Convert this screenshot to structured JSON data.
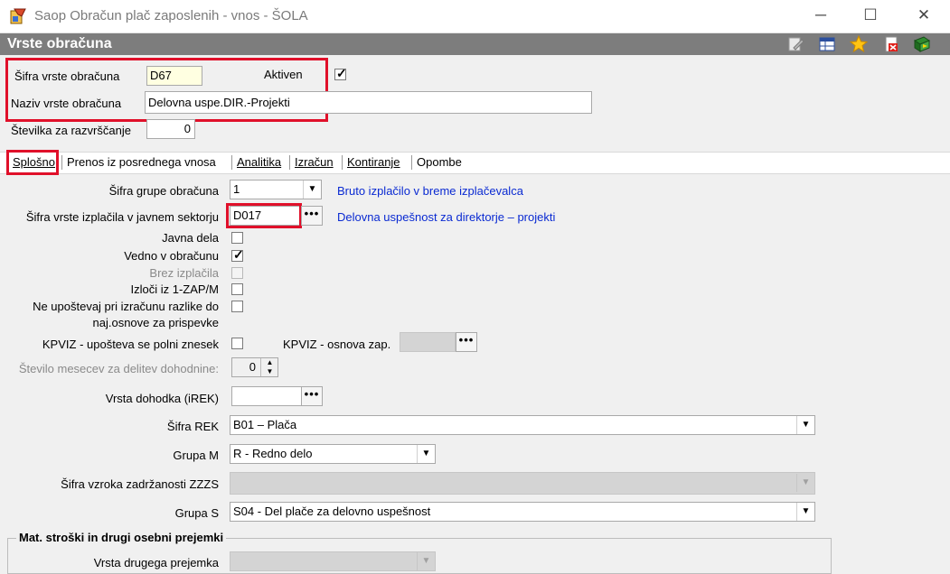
{
  "window": {
    "title": "Saop Obračun plač zaposlenih - vnos - ŠOLA",
    "minimize": "─",
    "maximize": "☐",
    "close": "✕"
  },
  "module": {
    "title": "Vrste obračuna"
  },
  "header": {
    "sifra_label": "Šifra vrste obračuna",
    "sifra_value": "D67",
    "aktiven_label": "Aktiven",
    "aktiven_checked": true,
    "naziv_label": "Naziv vrste obračuna",
    "naziv_value": "Delovna uspe.DIR.-Projekti",
    "stevilka_label": "Številka  za razvrščanje",
    "stevilka_value": "0"
  },
  "tabs": [
    {
      "label": "Splošno"
    },
    {
      "label": "Prenos iz posrednega vnosa"
    },
    {
      "label": "Analitika"
    },
    {
      "label": "Izračun"
    },
    {
      "label": "Kontiranje"
    },
    {
      "label": "Opombe"
    }
  ],
  "general": {
    "grupa_label": "Šifra grupe obračuna",
    "grupa_value": "1",
    "grupa_desc": "Bruto izplačilo v breme izplačevalca",
    "izplacilo_label": "Šifra vrste izplačila v javnem sektorju",
    "izplacilo_value": "D017",
    "izplacilo_desc": "Delovna uspešnost za direktorje – projekti",
    "javna_dela_label": "Javna dela",
    "vedno_label": "Vedno v obračunu",
    "vedno_checked": true,
    "brez_label": "Brez izplačila",
    "izloci_label": "Izloči iz 1-ZAP/M",
    "neupostevaj_label_1": "Ne upoštevaj pri izračunu razlike do",
    "neupostevaj_label_2": "naj.osnove za prispevke",
    "kpviz_label": "KPVIZ - upošteva se polni znesek",
    "kpviz_osnova_label": "KPVIZ - osnova zap.",
    "mesecev_label": "Število mesecev za delitev dohodnine:",
    "mesecev_value": "0",
    "dohodek_label": "Vrsta dohodka (iREK)",
    "rek_label": "Šifra REK",
    "rek_value": "B01 – Plača",
    "grupa_m_label": "Grupa M",
    "grupa_m_value": "R - Redno delo",
    "zzzs_label": "Šifra vzroka zadržanosti ZZZS",
    "grupa_s_label": "Grupa S",
    "grupa_s_value": "S04 - Del plače za delovno uspešnost",
    "mat_group_title": "Mat. stroški in drugi osebni prejemki",
    "vrsta_prejemka_label": "Vrsta drugega prejemka"
  },
  "glyphs": {
    "check": "✓",
    "dropdown": "▼",
    "dots": "•••",
    "spin_up": "▲",
    "spin_down": "▼"
  },
  "colors": {
    "header_bg": "#7d7d7d",
    "highlight": "#e0102a",
    "link_blue": "#0a2ad2"
  }
}
